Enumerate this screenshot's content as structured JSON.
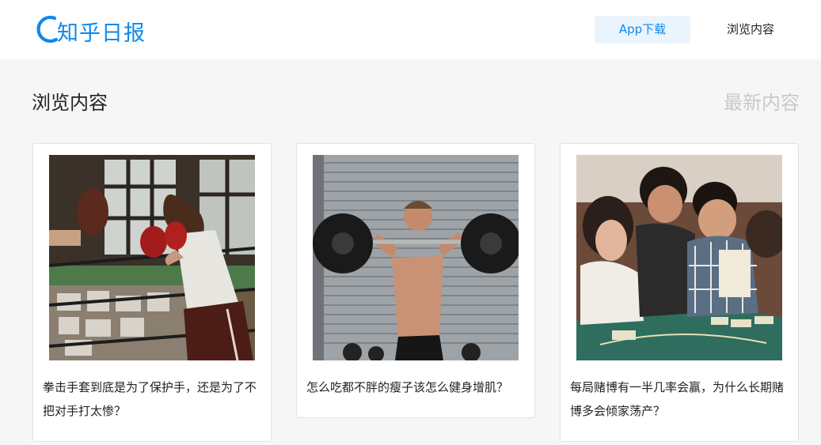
{
  "header": {
    "logo_text": "知乎日报",
    "app_download": "App下载",
    "browse": "浏览内容"
  },
  "section": {
    "title": "浏览内容",
    "latest": "最新内容"
  },
  "cards": [
    {
      "title": "拳击手套到底是为了保护手，还是为了不把对手打太惨？"
    },
    {
      "title": "怎么吃都不胖的瘦子该怎么健身增肌？"
    },
    {
      "title": "每局赌博有一半几率会赢，为什么长期赌博多会倾家荡产？"
    }
  ],
  "colors": {
    "brand": "#0f88eb",
    "background": "#f6f6f6",
    "latest_muted": "#c9c9c9"
  }
}
